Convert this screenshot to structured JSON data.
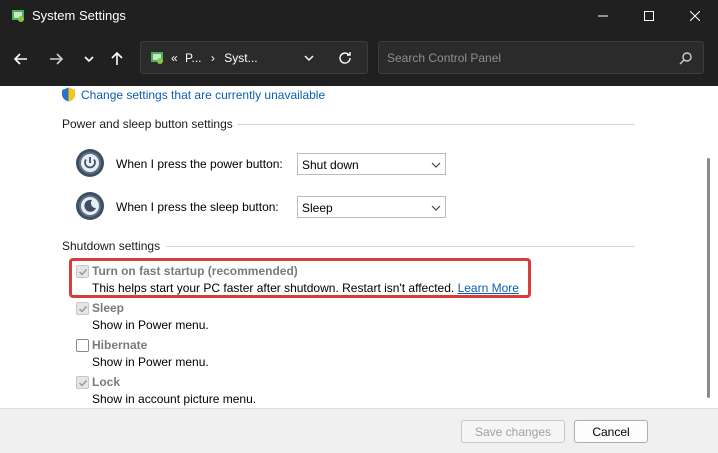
{
  "window": {
    "title": "System Settings"
  },
  "address": {
    "path_prefix": "«",
    "path_segment_1": "P...",
    "path_sep": "›",
    "path_segment_2": "Syst...",
    "search_placeholder": "Search Control Panel"
  },
  "content": {
    "change_settings_link": "Change settings that are currently unavailable",
    "power_section": {
      "heading": "Power and sleep button settings",
      "power_button_label": "When I press the power button:",
      "power_button_value": "Shut down",
      "sleep_button_label": "When I press the sleep button:",
      "sleep_button_value": "Sleep"
    },
    "shutdown_section": {
      "heading": "Shutdown settings",
      "options": [
        {
          "title": "Turn on fast startup (recommended)",
          "checked": true,
          "desc": "This helps start your PC faster after shutdown. Restart isn't affected.",
          "link": "Learn More"
        },
        {
          "title": "Sleep",
          "checked": true,
          "desc": "Show in Power menu."
        },
        {
          "title": "Hibernate",
          "checked": false,
          "desc": "Show in Power menu."
        },
        {
          "title": "Lock",
          "checked": true,
          "desc": "Show in account picture menu."
        }
      ]
    }
  },
  "footer": {
    "save_label": "Save changes",
    "cancel_label": "Cancel"
  },
  "colors": {
    "titlebar": "#202020",
    "link": "#0a5fb4",
    "highlight": "#d93c3c"
  }
}
